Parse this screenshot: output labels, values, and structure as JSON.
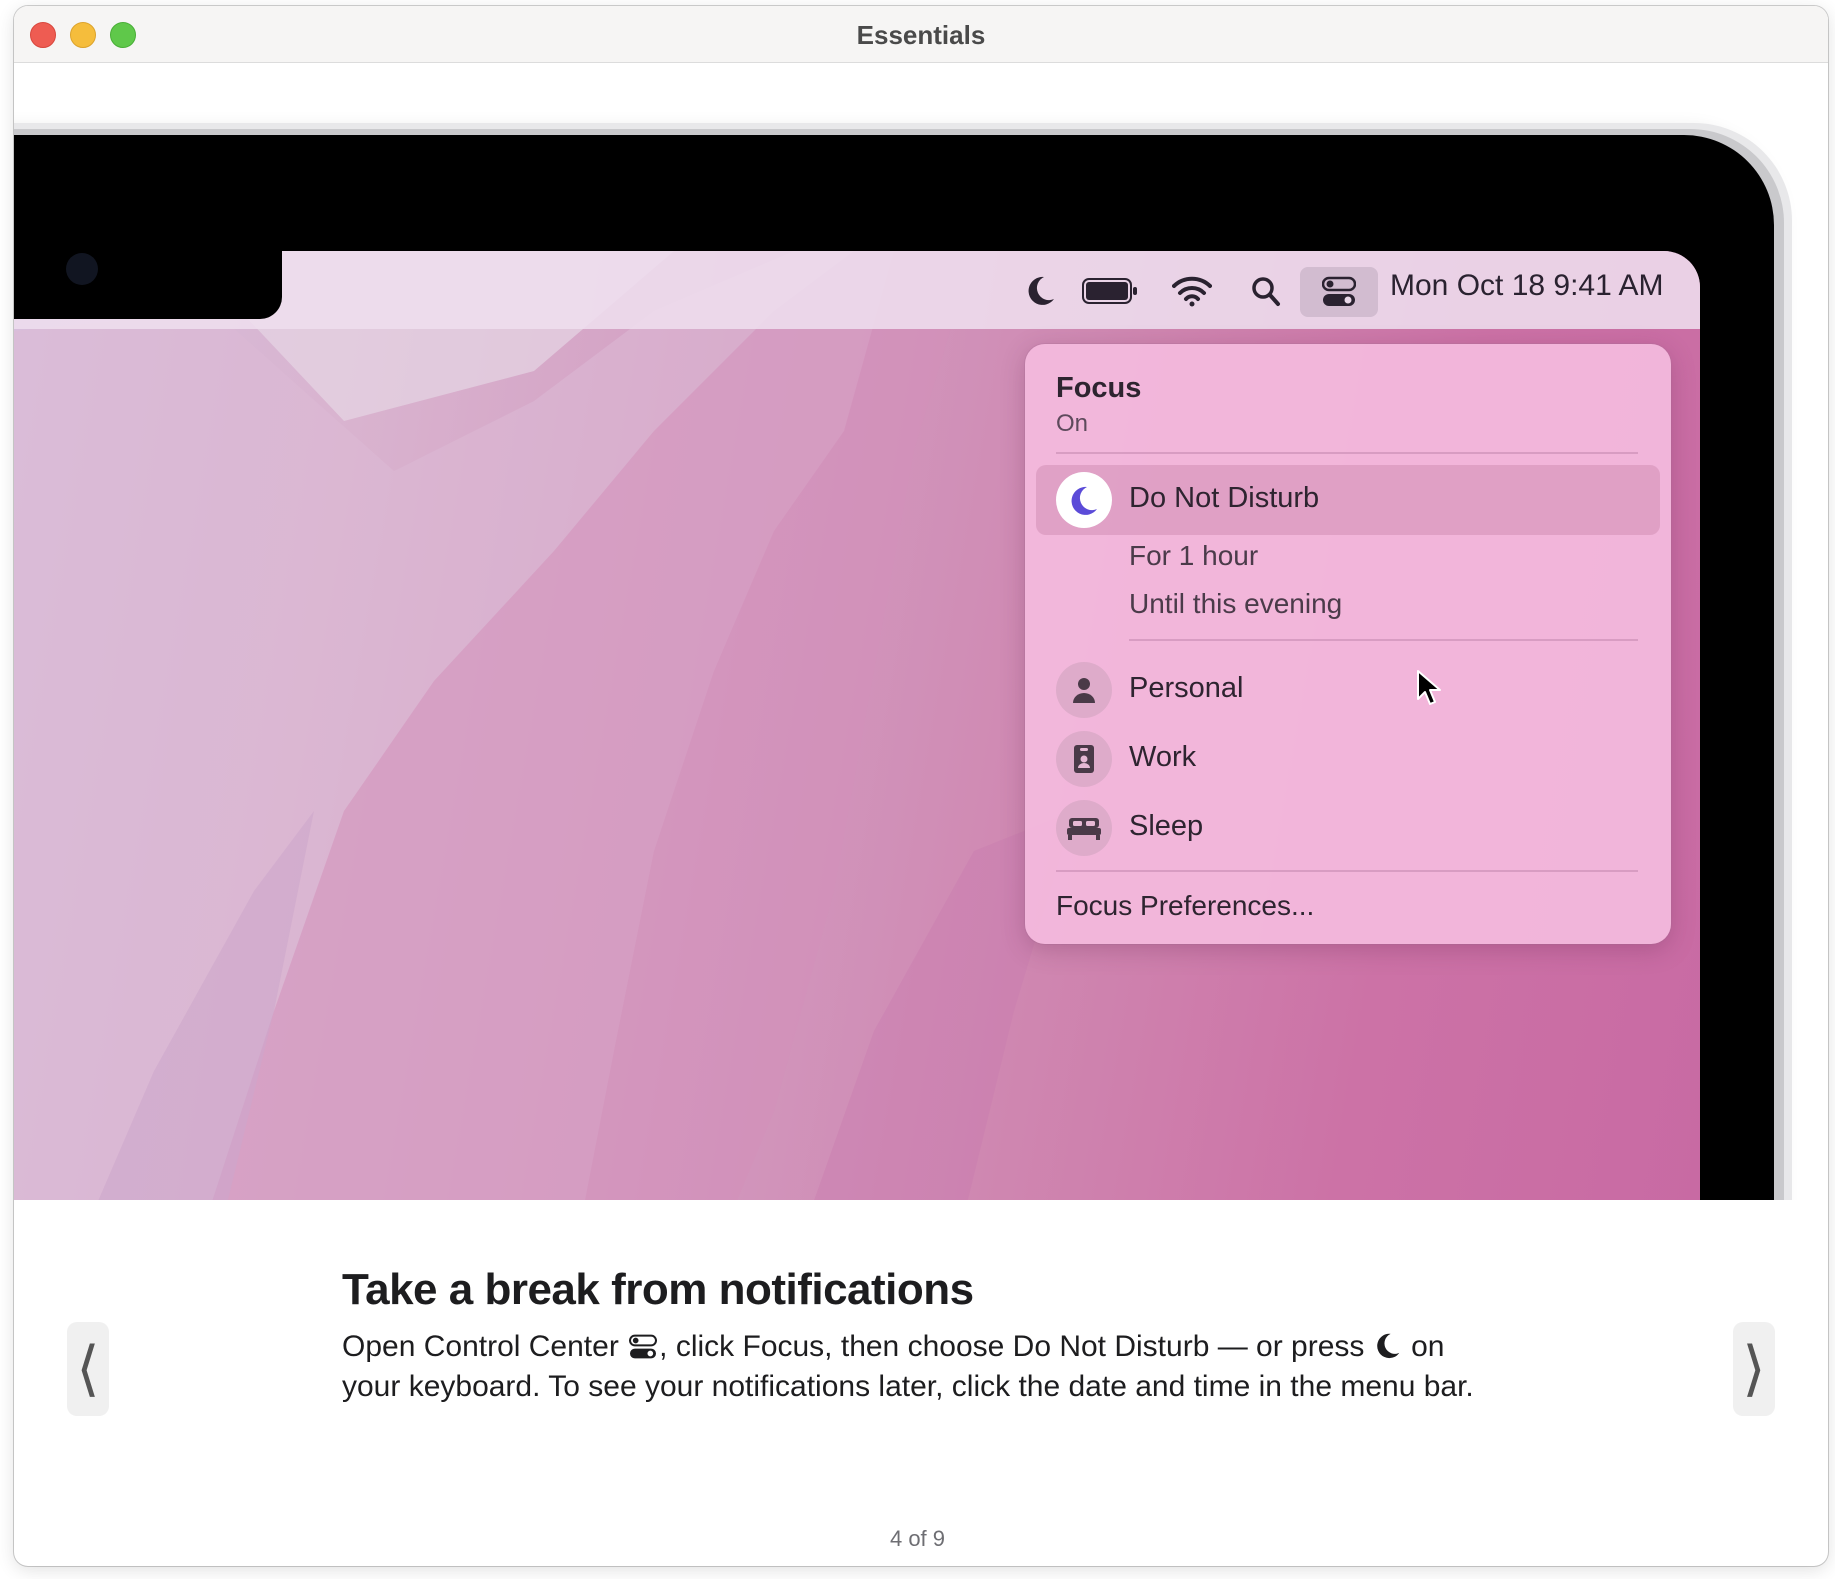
{
  "window": {
    "title": "Essentials"
  },
  "menubar": {
    "clock": "Mon Oct 18  9:41 AM",
    "icons": [
      "moon-icon",
      "battery-icon",
      "wifi-icon",
      "search-icon",
      "control-center-icon"
    ]
  },
  "focus_panel": {
    "title": "Focus",
    "status": "On",
    "dnd_label": "Do Not Disturb",
    "dnd_options": [
      "For 1 hour",
      "Until this evening"
    ],
    "modes": [
      {
        "label": "Personal",
        "icon": "person-icon"
      },
      {
        "label": "Work",
        "icon": "id-badge-icon"
      },
      {
        "label": "Sleep",
        "icon": "bed-icon"
      }
    ],
    "preferences": "Focus Preferences..."
  },
  "content": {
    "headline": "Take a break from notifications",
    "body_part1": "Open Control Center",
    "body_part2": ", click Focus, then choose Do Not Disturb — or press",
    "body_part3": " on your keyboard. To see your notifications later, click the date and time in the menu bar."
  },
  "navigation": {
    "prev_glyph": "⟨",
    "next_glyph": "⟩",
    "page_counter": "4 of 9"
  },
  "colors": {
    "accent_dnd": "#5b4bd8",
    "panel_bg": "#f4bade",
    "wallpaper_pink": "#cc72a6"
  }
}
